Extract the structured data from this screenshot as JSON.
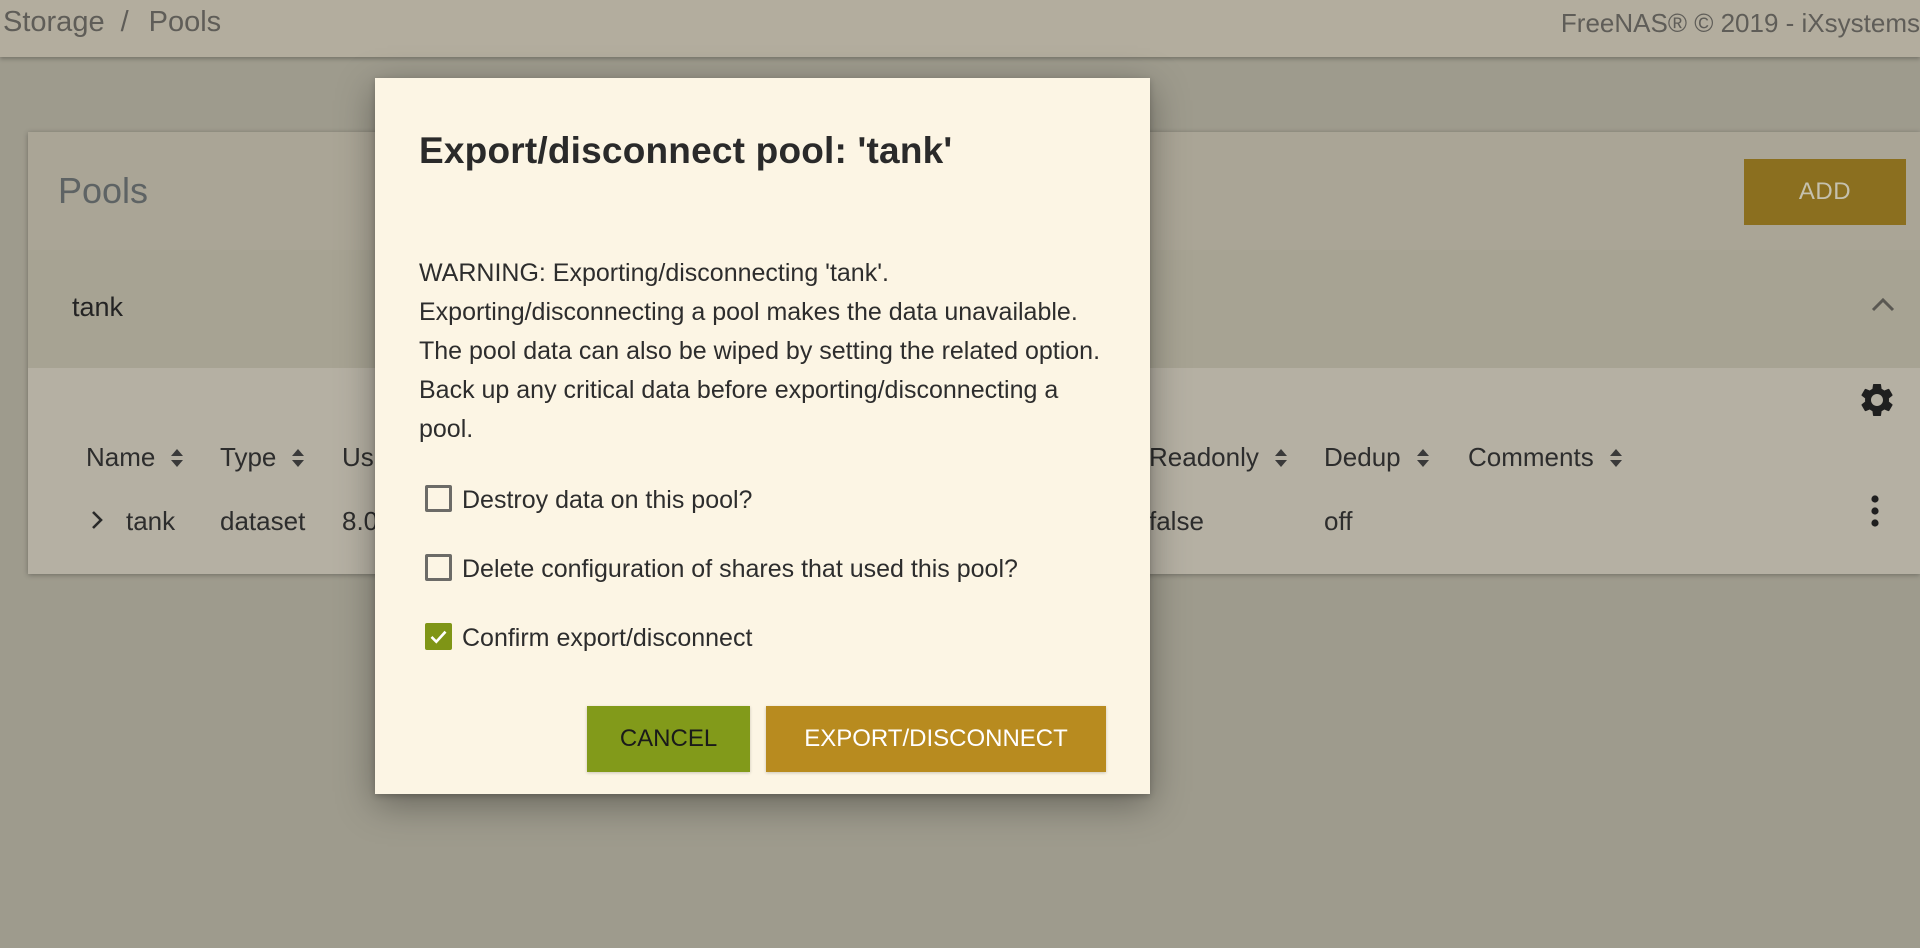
{
  "header": {
    "breadcrumb": [
      "Storage",
      "Pools"
    ],
    "breadcrumb_separator": "/",
    "copyright": "FreeNAS® © 2019 - iXsystems"
  },
  "card": {
    "title": "Pools",
    "add_label": "ADD",
    "pool_name": "tank"
  },
  "table": {
    "headers": {
      "name": "Name",
      "type": "Type",
      "used": "Us",
      "readonly": "Readonly",
      "dedup": "Dedup",
      "comments": "Comments"
    },
    "row": {
      "name": "tank",
      "type": "dataset",
      "used": "8.0",
      "readonly": "false",
      "dedup": "off"
    }
  },
  "modal": {
    "title": "Export/disconnect pool: 'tank'",
    "message": "WARNING: Exporting/disconnecting 'tank'. Exporting/disconnecting a pool makes the data unavailable. The pool data can also be wiped by setting the related option. Back up any critical data before exporting/disconnecting a pool.",
    "options": [
      {
        "label": "Destroy data on this pool?",
        "checked": false
      },
      {
        "label": "Delete configuration of shares that used this pool?",
        "checked": false
      },
      {
        "label": "Confirm export/disconnect",
        "checked": true
      }
    ],
    "cancel_label": "CANCEL",
    "confirm_label": "EXPORT/DISCONNECT"
  },
  "colors": {
    "primary": "#b88b1f",
    "accent": "#829a1a",
    "dialog_bg": "#fcf5e4"
  }
}
